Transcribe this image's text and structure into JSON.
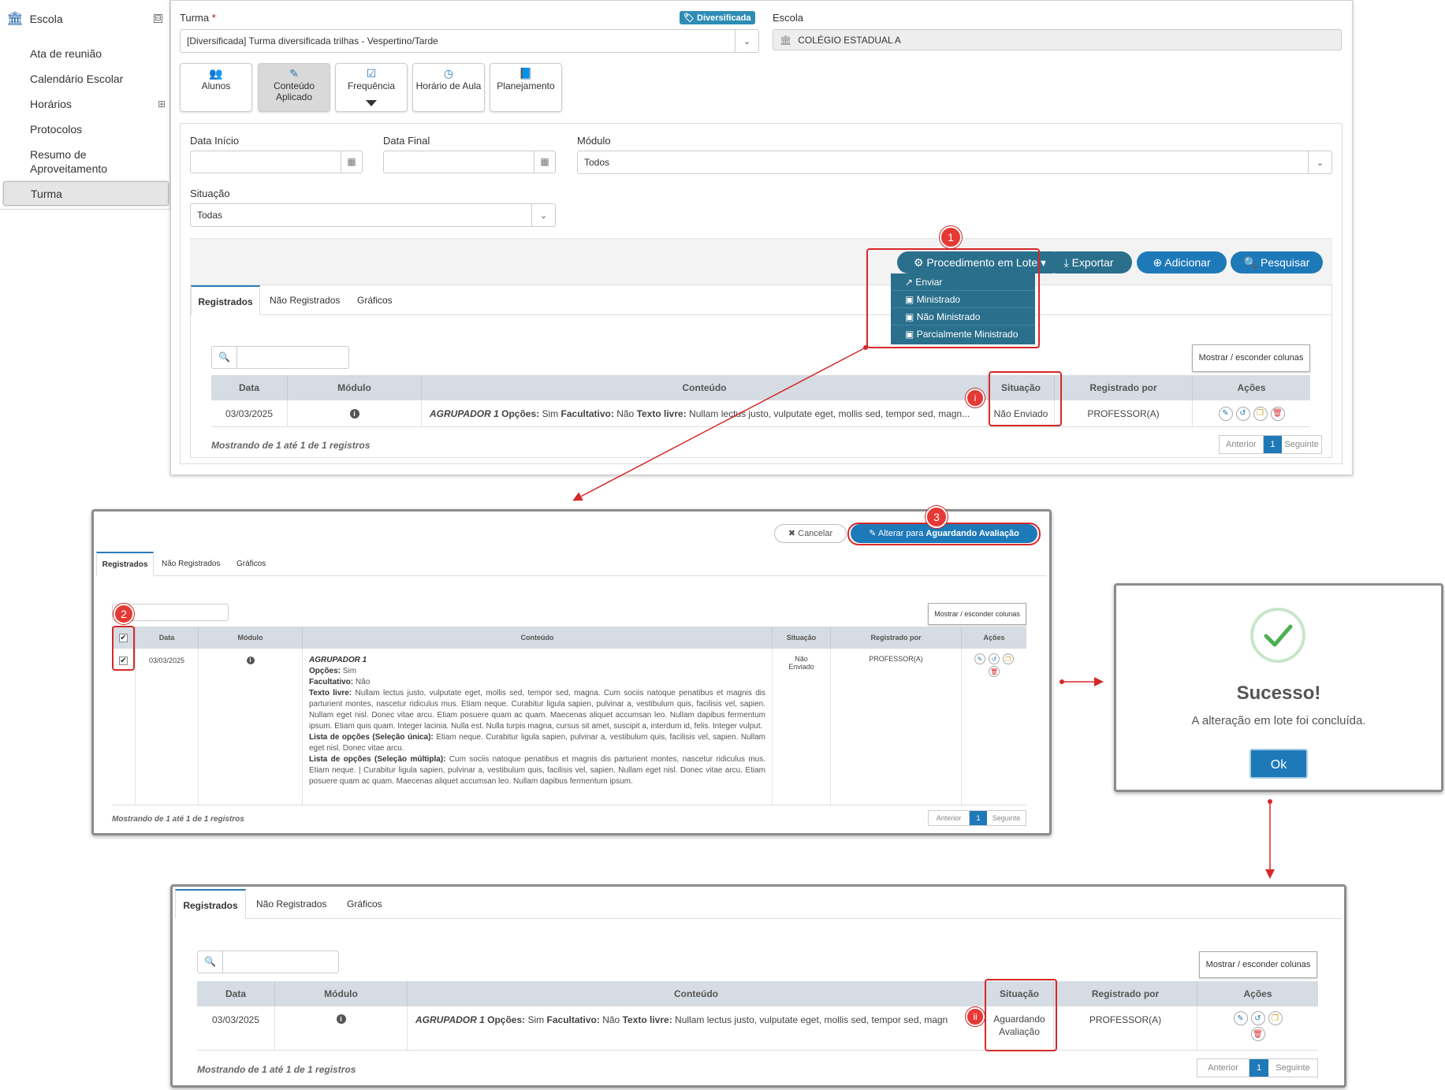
{
  "sidebar": {
    "title": "Escola",
    "toggle": "⊟",
    "items": [
      {
        "label": "Ata de reunião"
      },
      {
        "label": "Calendário Escolar"
      },
      {
        "label": "Horários",
        "toggle": "⊞"
      },
      {
        "label": "Protocolos"
      },
      {
        "label": "Resumo de Aproveitamento"
      },
      {
        "label": "Turma",
        "active": true
      }
    ]
  },
  "form": {
    "turma_label": "Turma",
    "required_mark": "*",
    "turma_badge": "Diversificada",
    "turma_value": "[Diversificada]  Turma diversificada trilhas - Vespertino/Tarde",
    "escola_label": "Escola",
    "escola_value": "COLÉGIO ESTADUAL A",
    "data_inicio_label": "Data Início",
    "data_final_label": "Data Final",
    "modulo_label": "Módulo",
    "modulo_value": "Todos",
    "situacao_label": "Situação",
    "situacao_value": "Todas"
  },
  "tiles": [
    {
      "label": "Alunos",
      "icon": "users-icon"
    },
    {
      "label": "Conteúdo Aplicado",
      "icon": "wand-icon",
      "active": true
    },
    {
      "label": "Frequência",
      "icon": "check-square-icon"
    },
    {
      "label": "Horário de Aula",
      "icon": "clock-icon"
    },
    {
      "label": "Planejamento",
      "icon": "book-icon"
    }
  ],
  "toolbar": {
    "lote_label": "Procedimento em Lote",
    "exportar_label": "Exportar",
    "adicionar_label": "Adicionar",
    "pesquisar_label": "Pesquisar"
  },
  "lote_menu": [
    "Enviar",
    "Ministrado",
    "Não Ministrado",
    "Parcialmente Ministrado"
  ],
  "tabs": [
    "Registrados",
    "Não Registrados",
    "Gráficos"
  ],
  "columns_button": "Mostrar / esconder colunas",
  "table": {
    "headers": [
      "Data",
      "Módulo",
      "Conteúdo",
      "Situação",
      "Registrado por",
      "Ações"
    ],
    "row": {
      "data": "03/03/2025",
      "conteudo_title": "AGRUPADOR 1",
      "opcoes_label": "Opções:",
      "opcoes_value": "Sim",
      "facultativo_label": "Facultativo:",
      "facultativo_value": "Não",
      "texto_livre_label": "Texto livre:",
      "texto_livre_preview": "Nullam lectus justo, vulputate eget, mollis sed, tempor sed, magn...",
      "texto_livre_preview_3": "Nullam lectus justo, vulputate eget, mollis sed, tempor sed, magn",
      "situacao": "Não Enviado",
      "registrado_por": "PROFESSOR(A)"
    },
    "footer": "Mostrando de 1 até 1 de 1 registros",
    "pager": {
      "prev": "Anterior",
      "page": "1",
      "next": "Seguinte"
    }
  },
  "panel2": {
    "cancel_label": "Cancelar",
    "alter_prefix": "Alterar para",
    "alter_strong": "Aguardando Avaliação",
    "situacao_line1": "Não",
    "situacao_line2": "Enviado",
    "texto_livre_full": "Nullam lectus justo, vulputate eget, mollis sed, tempor sed, magna. Cum sociis natoque penatibus et magnis dis parturient montes, nascetur ridiculus mus. Etiam neque. Curabitur ligula sapien, pulvinar a, vestibulum quis, facilisis vel, sapien. Nullam eget nisl. Donec vitae arcu. Etiam posuere quam ac quam. Maecenas aliquet accumsan leo. Nullam dapibus fermentum ipsum. Etiam quis quam. Integer lacinia. Nulla est. Nulla turpis magna, cursus sit amet, suscipit a, interdum id, felis. Integer vulput.",
    "lista_unica_label": "Lista de opções (Seleção única):",
    "lista_unica_value": "Etiam neque. Curabitur ligula sapien, pulvinar a, vestibulum quis, facilisis vel, sapien. Nullam eget nisl. Donec vitae arcu.",
    "lista_multipla_label": "Lista de opções (Seleção múltipla):",
    "lista_multipla_value": "Cum sociis natoque penatibus et magnis dis parturient montes, nascetur ridiculus mus. Etiam neque. | Curabitur ligula sapien, pulvinar a, vestibulum quis, facilisis vel, sapien. Nullam eget nisl. Donec vitae arcu. Etiam posuere quam ac quam. Maecenas aliquet accumsan leo. Nullam dapibus fermentum ipsum.",
    "footer": "Mostrando de 1 até 1 de 1 registros"
  },
  "dialog": {
    "title": "Sucesso!",
    "message": "A alteração em lote foi concluída.",
    "ok_label": "Ok"
  },
  "panel3": {
    "situacao_line1": "Aguardando",
    "situacao_line2": "Avaliação"
  },
  "markers": {
    "step1": "1",
    "step2": "2",
    "step3": "3",
    "i": "i",
    "ii": "ii"
  },
  "colors": {
    "accent": "#1e79b8",
    "dark_button": "#2a6f8c",
    "highlight": "#d62828",
    "success": "#4caf50"
  }
}
